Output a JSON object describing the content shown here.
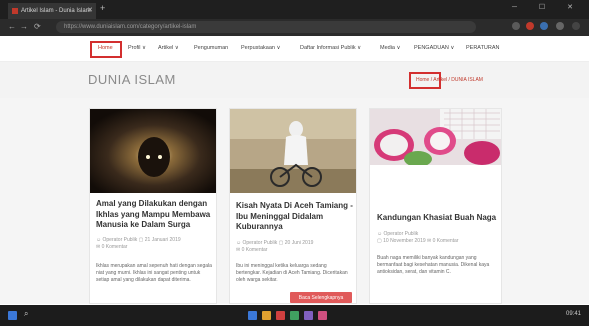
{
  "browser": {
    "tab_title": "Artikel Islam - Dunia Islam",
    "tab_close": "✕",
    "new_tab": "+",
    "window_controls": "─ ☐ ✕",
    "nav_back": "←",
    "nav_forward": "→",
    "nav_reload": "⟳",
    "url": "https://www.duniaislam.com/category/artikel-islam"
  },
  "nav": {
    "items": [
      "Home",
      "Profil ∨",
      "Artikel ∨",
      "Pengumuman",
      "Perpustakaan ∨",
      "Daftar Informasi Publik ∨",
      "Media ∨",
      "PENGADUAN ∨",
      "PERATURAN"
    ]
  },
  "page": {
    "title": "DUNIA ISLAM",
    "breadcrumb": "Home / Artikel / DUNIA ISLAM"
  },
  "cards": [
    {
      "title": "Amal yang Dilakukan dengan Ikhlas yang Mampu Membawa Manusia ke Dalam Surga",
      "author": "Operator Publik",
      "date": "21 Januari 2019",
      "comments": "0 Komentar",
      "excerpt": "Ikhlas merupakan amal sepenuh hati dengan segala niat yang murni. Ikhlas ini sangat penting untuk setiap amal yang dilakukan dapat diterima."
    },
    {
      "title": "Kisah Nyata Di Aceh Tamiang - Ibu Meninggal Didalam Kuburannya",
      "author": "Operator Publik",
      "date": "20 Juni 2019",
      "comments": "0 Komentar",
      "excerpt": "Ibu ini meninggal ketika keluarga sedang bertengkar. Kejadian di Aceh Tamiang. Diceritakan oleh warga sekitar."
    },
    {
      "title": "Kandungan Khasiat Buah Naga",
      "author": "Operator Publik",
      "date": "10 November 2019",
      "comments": "0 Komentar",
      "excerpt": "Buah naga memiliki banyak kandungan yang bermanfaat bagi kesehatan manusia. Dikenal kaya antioksidan, serat, dan vitamin C."
    }
  ],
  "read_more": "Baca Selengkapnya",
  "taskbar": {
    "search": "⌕",
    "tray_time": "09:41"
  },
  "colors": {
    "accent": "#d32f2f",
    "button": "#e05a5a"
  }
}
